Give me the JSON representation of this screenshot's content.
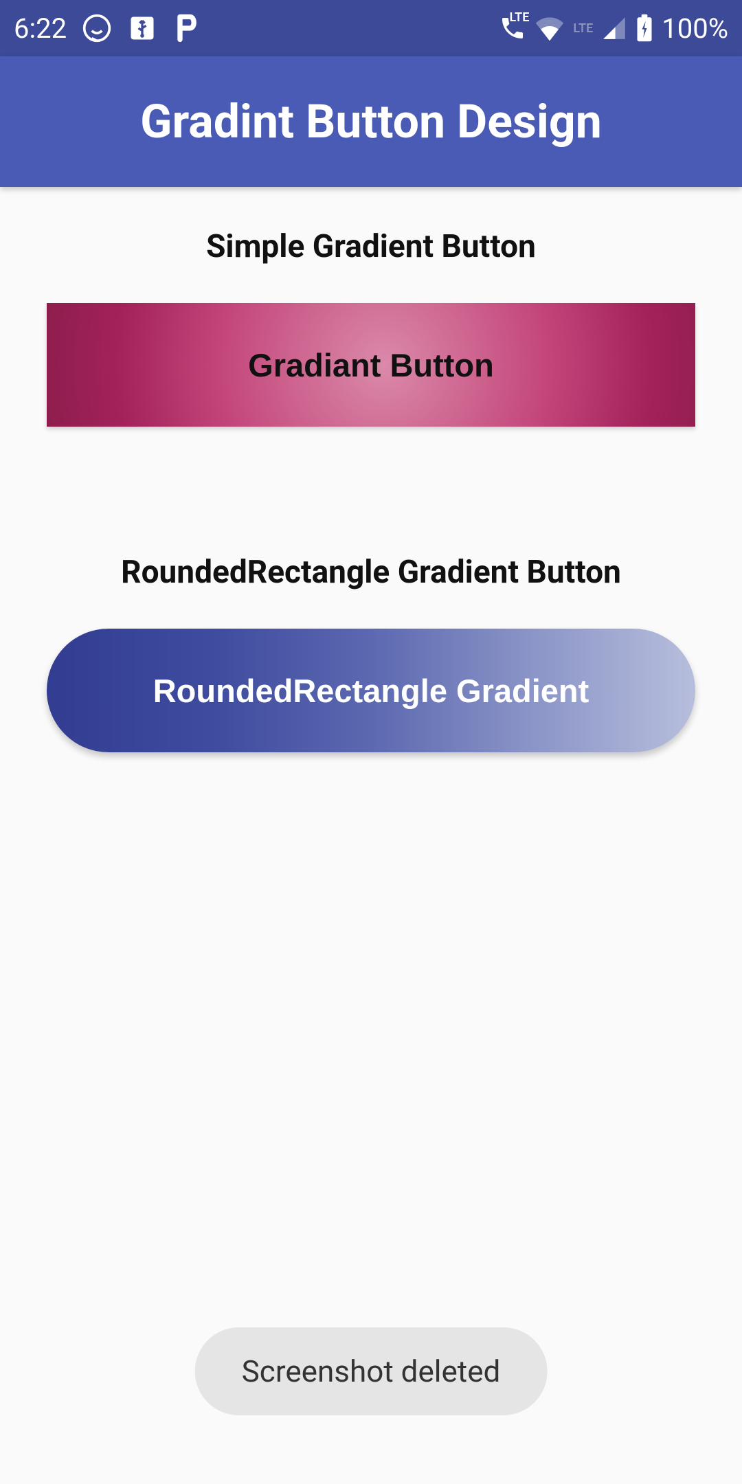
{
  "status_bar": {
    "time": "6:22",
    "battery_pct": "100%",
    "lte_label": "LTE",
    "icons": {
      "whatsapp": "whatsapp-icon",
      "usb": "usb-icon",
      "p_app": "p-app-icon",
      "call": "call-icon",
      "wifi": "wifi-icon",
      "signal": "signal-icon",
      "battery": "battery-charging-icon"
    }
  },
  "app_bar": {
    "title": "Gradint Button Design"
  },
  "sections": {
    "simple": {
      "heading": "Simple Gradient Button",
      "button_label": "Gradiant Button"
    },
    "rounded": {
      "heading": "RoundedRectangle Gradient Button",
      "button_label": "RoundedRectangle Gradient"
    }
  },
  "toast": {
    "message": "Screenshot deleted"
  },
  "colors": {
    "status_bar_bg": "#3c4a97",
    "app_bar_bg": "#4a5bb6",
    "simple_gradient_start": "#8a1c4b",
    "simple_gradient_end": "#da8aaa",
    "rounded_gradient_start": "#323d92",
    "rounded_gradient_end": "#b7bedc"
  }
}
